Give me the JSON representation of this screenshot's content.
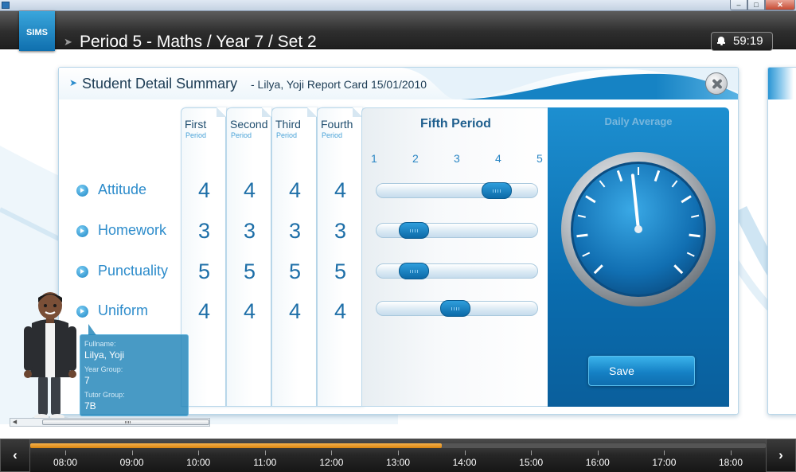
{
  "header": {
    "logo": "SIMS",
    "title": "Period 5 - Maths / Year 7 / Set 2",
    "timer": "59:19",
    "bell_icon": "bell-icon"
  },
  "window": {
    "minimize": "–",
    "maximize": "□",
    "close": "✕"
  },
  "panel": {
    "title": "Student Detail Summary",
    "subtitle": "- Lilya, Yoji Report Card 15/01/2010",
    "close_icon": "close-icon"
  },
  "criteria": [
    {
      "label": "Attitude"
    },
    {
      "label": "Homework"
    },
    {
      "label": "Punctuality"
    },
    {
      "label": "Uniform"
    }
  ],
  "periods": [
    {
      "name": "First",
      "sub": "Period",
      "scores": [
        "4",
        "3",
        "5",
        "4"
      ]
    },
    {
      "name": "Second",
      "sub": "Period",
      "scores": [
        "4",
        "3",
        "5",
        "4"
      ]
    },
    {
      "name": "Third",
      "sub": "Period",
      "scores": [
        "4",
        "3",
        "5",
        "4"
      ]
    },
    {
      "name": "Fourth",
      "sub": "Period",
      "scores": [
        "4",
        "3",
        "5",
        "4"
      ]
    }
  ],
  "fifth_period": {
    "title": "Fifth Period",
    "scale": [
      "1",
      "2",
      "3",
      "4",
      "5"
    ],
    "slider_values": [
      4,
      2,
      2,
      3
    ]
  },
  "daily_average": {
    "title": "Daily Average",
    "save_label": "Save",
    "gauge_fraction": 0.5
  },
  "student_card": {
    "fullname_label": "Fullname:",
    "fullname": "Lilya, Yoji",
    "year_group_label": "Year Group:",
    "year_group": "7",
    "tutor_group_label": "Tutor Group:",
    "tutor_group": "7B"
  },
  "timeline": {
    "hours": [
      "08:00",
      "09:00",
      "10:00",
      "11:00",
      "12:00",
      "13:00",
      "14:00",
      "15:00",
      "16:00",
      "17:00",
      "18:00"
    ],
    "progress_fraction": 0.559,
    "prev_label": "‹",
    "next_label": "›"
  },
  "colors": {
    "accent": "#1b84c4",
    "timeline_progress": "#e8951e",
    "header_bg": "#2e2e2e"
  }
}
